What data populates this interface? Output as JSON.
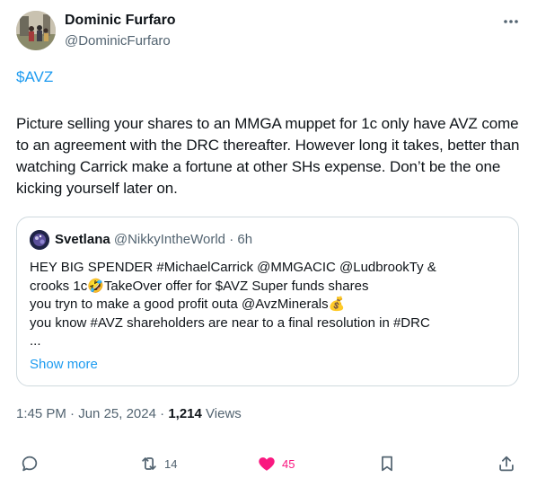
{
  "author": {
    "name": "Dominic Furfaro",
    "handle": "@DominicFurfaro"
  },
  "post": {
    "cashtag": "$AVZ",
    "text": "Picture selling your shares to an MMGA muppet for 1c only have AVZ come to an agreement with the DRC thereafter. However long it takes, better than watching Carrick make a fortune at other SHs expense. Don’t be the one kicking yourself later on."
  },
  "quote": {
    "name": "Svetlana",
    "handle": "@NikkyIntheWorld",
    "separator": "·",
    "age": "6h",
    "text": "HEY BIG SPENDER #MichaelCarrick @MMGACIC @LudbrookTy &\ncrooks 1c🤣TakeOver offer for $AVZ Super funds shares\nyou tryn to make a good profit outa @AvzMinerals💰\nyou know #AVZ shareholders are near to a final resolution in #DRC\n...",
    "show_more": "Show more"
  },
  "meta": {
    "time": "1:45 PM",
    "separator": "·",
    "date": "Jun 25, 2024",
    "views_count": "1,214",
    "views_label": "Views"
  },
  "actions": {
    "retweets": "14",
    "likes": "45"
  },
  "colors": {
    "accent": "#1d9bf0",
    "like": "#f91880",
    "muted": "#536471",
    "text": "#0f1419"
  }
}
